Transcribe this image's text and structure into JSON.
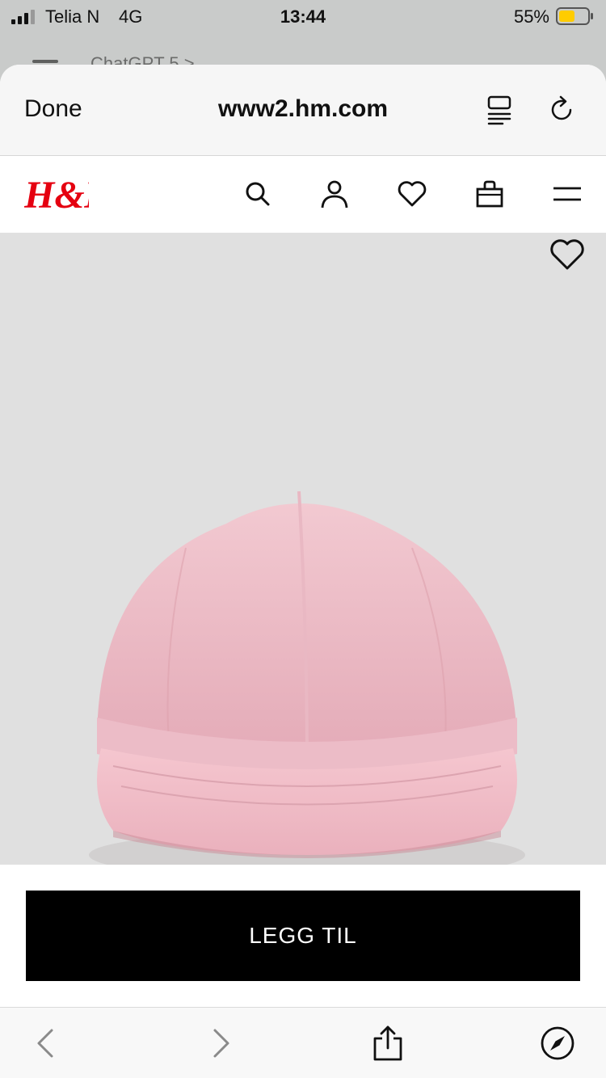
{
  "status_bar": {
    "carrier": "Telia N",
    "network": "4G",
    "time": "13:44",
    "battery_percent": "55%",
    "battery_color": "#ffcc00"
  },
  "background_app": {
    "title": "ChatGPT 5 >"
  },
  "browser": {
    "done_label": "Done",
    "url": "www2.hm.com",
    "icons": [
      "reader-icon",
      "reload-icon"
    ]
  },
  "site": {
    "logo_text": "H&M",
    "brand_color": "#e50010",
    "nav_icons": [
      "search-icon",
      "account-icon",
      "favorites-icon",
      "bag-icon",
      "menu-icon"
    ]
  },
  "product": {
    "image_subject": "pink muslin baseball cap",
    "favorite_icon": "heart-icon",
    "add_button_label": "LEGG TIL"
  },
  "toolbar": {
    "icons": [
      "back-icon",
      "forward-icon",
      "share-icon",
      "compass-icon"
    ]
  }
}
